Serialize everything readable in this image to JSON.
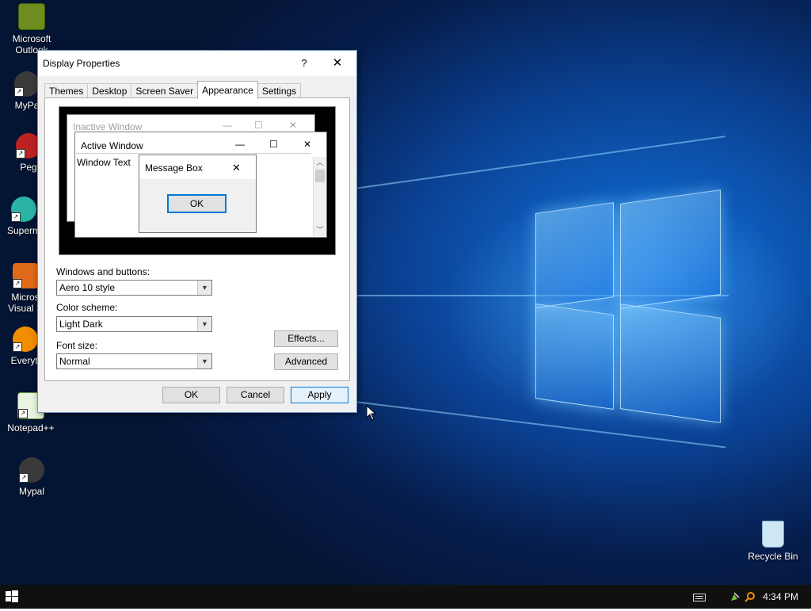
{
  "desktop": {
    "icons": [
      {
        "label": "Microsoft\nOutlook"
      },
      {
        "label": "MyPa"
      },
      {
        "label": "Peg"
      },
      {
        "label": "Superm"
      },
      {
        "label": "Micros\nVisual S"
      },
      {
        "label": "Everytl"
      },
      {
        "label": "Notepad++"
      },
      {
        "label": "Mypal"
      },
      {
        "label": "Recycle Bin"
      }
    ]
  },
  "dialog": {
    "title": "Display Properties",
    "help_label": "?",
    "close_label": "✕",
    "tabs": [
      {
        "label": "Themes"
      },
      {
        "label": "Desktop"
      },
      {
        "label": "Screen Saver"
      },
      {
        "label": "Appearance"
      },
      {
        "label": "Settings"
      }
    ],
    "preview": {
      "inactive_title": "Inactive Window",
      "active_title": "Active Window",
      "window_text": "Window Text",
      "message_box_title": "Message Box",
      "ok_label": "OK",
      "minimize": "—",
      "maximize": "☐",
      "close": "✕"
    },
    "fields": {
      "windows_buttons_label": "Windows and buttons:",
      "windows_buttons_value": "Aero 10 style",
      "color_scheme_label": "Color scheme:",
      "color_scheme_value": "Light Dark",
      "font_size_label": "Font size:",
      "font_size_value": "Normal"
    },
    "buttons": {
      "effects": "Effects...",
      "advanced": "Advanced",
      "ok": "OK",
      "cancel": "Cancel",
      "apply": "Apply"
    }
  },
  "taskbar": {
    "clock": "4:34 PM"
  },
  "colors": {
    "accent": "#0078d7",
    "taskbar": "#101010",
    "desktop_blue": "#0a3f8f"
  }
}
